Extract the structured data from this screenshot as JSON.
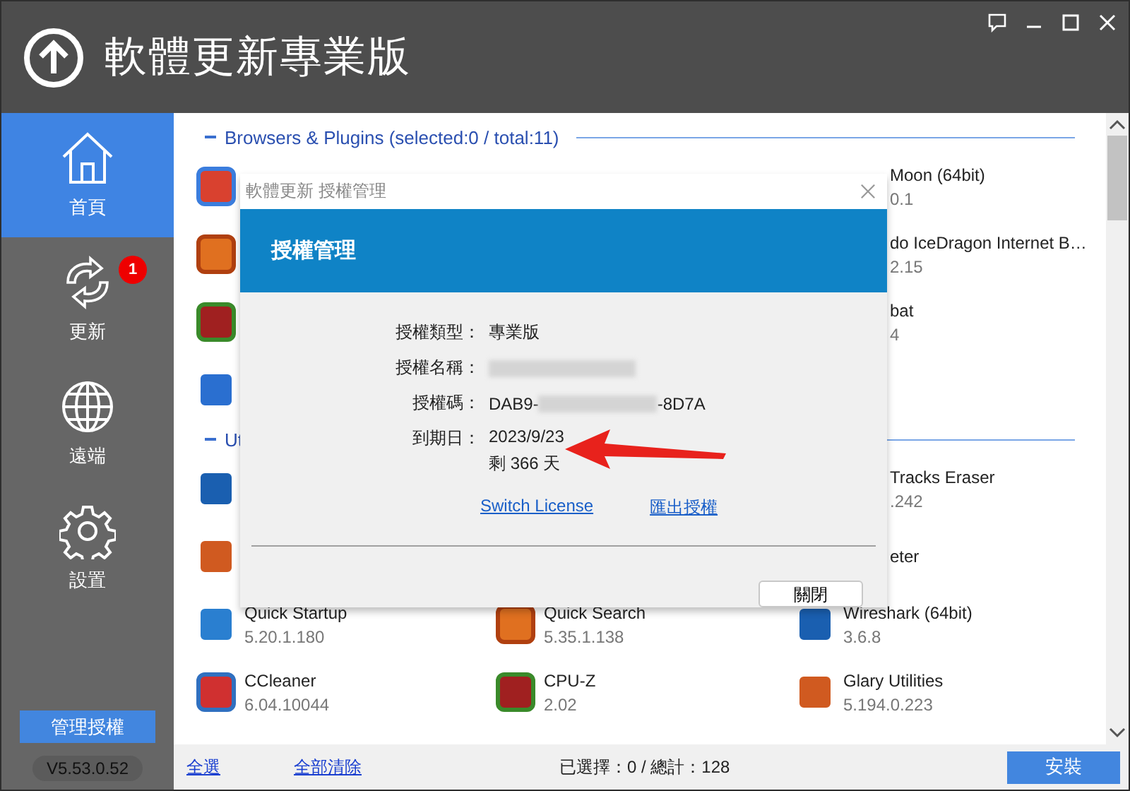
{
  "window": {
    "title": "軟體更新專業版"
  },
  "sidebar": {
    "items": [
      {
        "label": "首頁",
        "selected": true
      },
      {
        "label": "更新",
        "selected": false,
        "badge": "1"
      },
      {
        "label": "遠端",
        "selected": false
      },
      {
        "label": "設置",
        "selected": false
      }
    ],
    "license_button": "管理授權",
    "version": "V5.53.0.52"
  },
  "sections": [
    {
      "header": "Browsers & Plugins (selected:0 / total:11)",
      "rows": [
        {
          "column_3": {
            "name": "Moon (64bit)",
            "version": "0.1",
            "partial": true
          }
        },
        {
          "column_3": {
            "name": "do IceDragon Internet B…",
            "version": "2.15",
            "partial": true
          }
        },
        {
          "column_3": {
            "name": "bat",
            "version": "4",
            "partial": true
          }
        }
      ]
    },
    {
      "header": "Ut",
      "rows": [
        {
          "column_3": {
            "name": "Tracks Eraser",
            "version": ".242",
            "partial": true
          }
        },
        {
          "column_3": {
            "name": "eter",
            "partial": true
          }
        },
        {
          "column_1": {
            "name": "Quick Startup",
            "version": "5.20.1.180"
          },
          "column_2": {
            "name": "Quick Search",
            "version": "5.35.1.138"
          },
          "column_3": {
            "name": "Wireshark (64bit)",
            "version": "3.6.8",
            "partial": false
          }
        },
        {
          "column_1": {
            "name": "CCleaner",
            "version": "6.04.10044"
          },
          "column_2": {
            "name": "CPU-Z",
            "version": "2.02"
          },
          "column_3": {
            "name": "Glary Utilities",
            "version": "5.194.0.223",
            "partial": false
          }
        }
      ]
    }
  ],
  "footer": {
    "select_all": "全選",
    "clear_all": "全部清除",
    "summary": "已選擇：0 / 總計：128",
    "install_button": "安裝"
  },
  "dialog": {
    "title": "軟體更新 授權管理",
    "heading": "授權管理",
    "fields": [
      {
        "label": "授權類型：",
        "kind": "text",
        "value": "專業版"
      },
      {
        "label": "授權名稱：",
        "kind": "redacted"
      },
      {
        "label": "授權碼：",
        "kind": "masked_code",
        "value_start": "DAB9-",
        "value_end": "-8D7A"
      },
      {
        "label": "到期日：",
        "kind": "lines",
        "lines": [
          "2023/9/23",
          "剩 366 天"
        ]
      }
    ],
    "links": [
      "Switch License",
      "匯出授權"
    ],
    "close_button": "關閉"
  }
}
